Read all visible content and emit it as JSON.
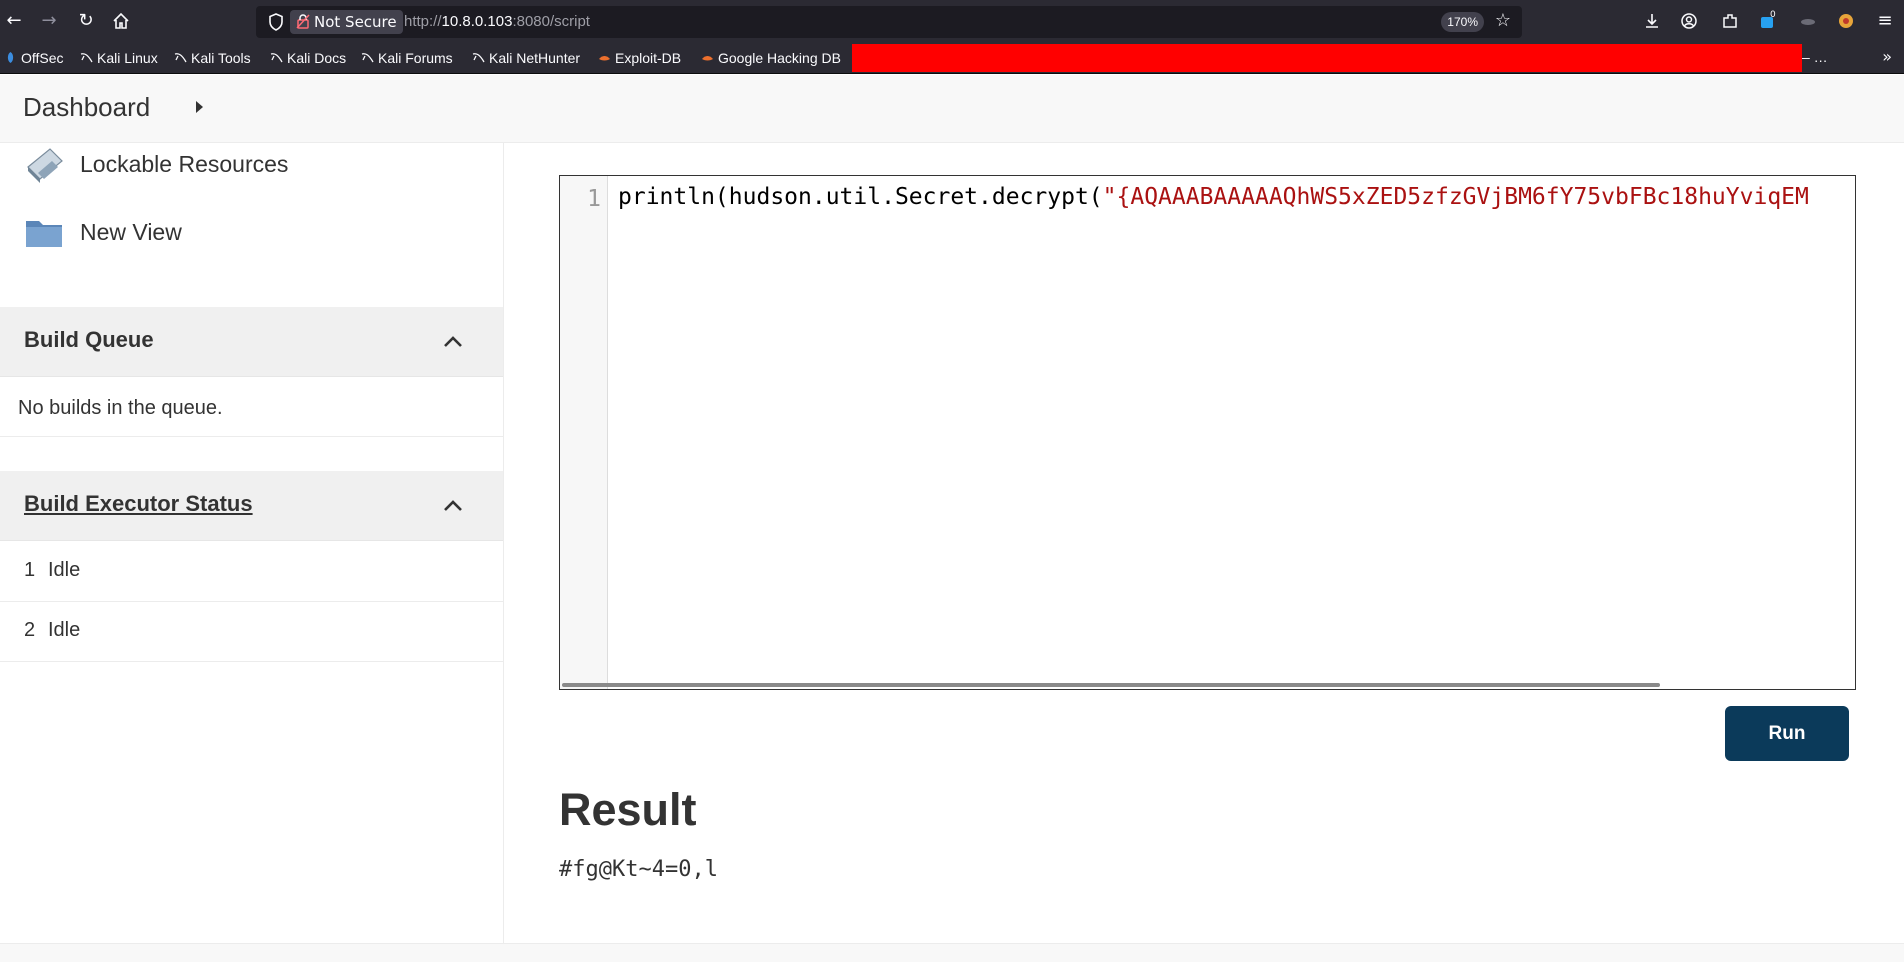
{
  "browser": {
    "url_scheme": "http://",
    "url_host": "10.8.0.103",
    "url_rest": ":8080/script",
    "security_label": "Not Secure",
    "zoom": "170%",
    "extensions_badge": "0",
    "bookmarks": [
      "OffSec",
      "Kali Linux",
      "Kali Tools",
      "Kali Docs",
      "Kali Forums",
      "Kali NetHunter",
      "Exploit-DB",
      "Google Hacking DB"
    ],
    "bookmarks_overflow": "– …",
    "icons": [
      "back-icon",
      "forward-icon",
      "reload-icon",
      "home-icon",
      "shield-icon",
      "lock-icon",
      "star-icon",
      "download-icon",
      "account-icon",
      "extensions-icon",
      "menu-icon"
    ]
  },
  "breadcrumb": {
    "label": "Dashboard"
  },
  "sidebar": {
    "tasks": [
      {
        "label": "Lockable Resources",
        "icon": "lockable-resources-icon"
      },
      {
        "label": "New View",
        "icon": "folder-icon"
      }
    ],
    "build_queue": {
      "title": "Build Queue",
      "empty_text": "No builds in the queue."
    },
    "executors": {
      "title": "Build Executor Status",
      "items": [
        {
          "num": "1",
          "status": "Idle"
        },
        {
          "num": "2",
          "status": "Idle"
        }
      ]
    }
  },
  "main": {
    "editor": {
      "line_number": "1",
      "code_prefix": "println(hudson.util.Secret.decrypt(",
      "code_string": "\"{AQAAABAAAAAQhWS5xZED5zfzGVjBM6fY75vbFBc18huYviqEM"
    },
    "run_label": "Run",
    "result_title": "Result",
    "result_output": "#fg@Kt~4=0,l"
  },
  "colors": {
    "chrome_bg": "#2b2a33",
    "urlbar_bg": "#1c1b22",
    "run_button": "#0b3a5a",
    "code_string": "#aa1111",
    "redaction": "#ff0000"
  }
}
